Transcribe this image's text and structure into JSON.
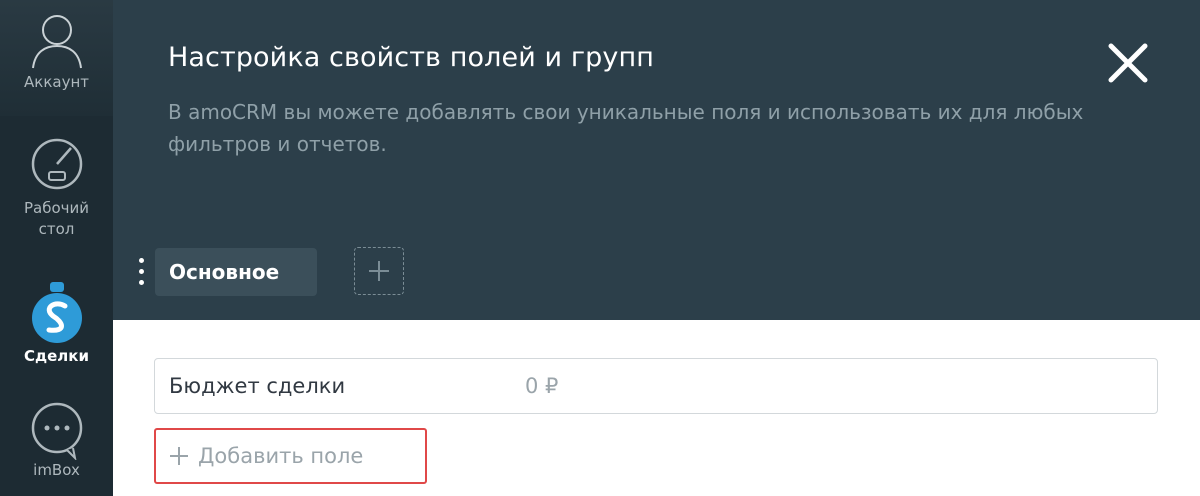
{
  "sidebar": {
    "items": [
      {
        "label": "Аккаунт",
        "icon": "user-silhouette-icon"
      },
      {
        "label": "Рабочий стол",
        "icon": "speedometer-icon"
      },
      {
        "label": "Сделки",
        "icon": "dollar-bag-icon"
      },
      {
        "label": "imBox",
        "icon": "chat-bubble-icon"
      }
    ]
  },
  "header": {
    "title": "Настройка свойств полей и групп",
    "subtitle": "В amoCRM вы можете добавлять свои уникальные поля и использовать их для любых фильтров и отчетов.",
    "close_icon": "close-icon"
  },
  "tabs": [
    {
      "label": "Основное",
      "active": true
    }
  ],
  "fields": [
    {
      "label": "Бюджет сделки",
      "value": "0 ₽"
    }
  ],
  "add_field": {
    "label": "Добавить поле"
  },
  "colors": {
    "sidebar_bg": "#1d2b33",
    "header_bg": "#2c3f4a",
    "highlight_border": "#e04848",
    "deals_icon": "#2e9bd8"
  }
}
